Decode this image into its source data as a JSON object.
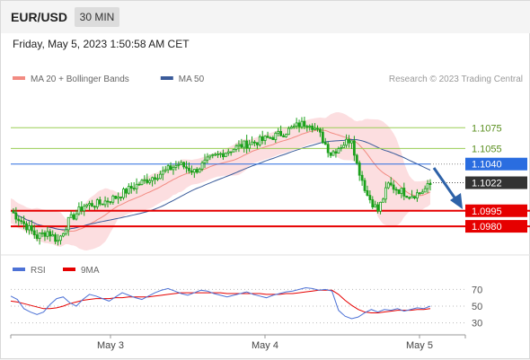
{
  "header": {
    "symbol": "EUR/USD",
    "timeframe": "30 MIN"
  },
  "datetime": "Friday, May 5, 2023 1:50:58 AM CET",
  "attribution": "Research © 2023 Trading Central",
  "colors": {
    "ma20": "#f28b82",
    "ma50": "#3b5b9a",
    "bollinger": "#fbd3d5",
    "green_level": "#9acd55",
    "blue_level": "#2a6de0",
    "red_level": "#e60000",
    "candle": "#1aa01a",
    "rsi": "#4d72d6",
    "rsi_ma": "#e60000",
    "arrow": "#2e62a8"
  },
  "chart_data": [
    {
      "type": "candlestick",
      "legend": [
        {
          "name": "MA 20 + Bollinger Bands",
          "color": "#f28b82"
        },
        {
          "name": "MA 50",
          "color": "#3b5b9a"
        }
      ],
      "x_ticks": [
        "May 3",
        "May 4",
        "May 5"
      ],
      "ylim": [
        1.0955,
        1.1115
      ],
      "levels": [
        {
          "value": 1.1075,
          "label": "1.1075",
          "kind": "target"
        },
        {
          "value": 1.1055,
          "label": "1.1055",
          "kind": "target"
        },
        {
          "value": 1.104,
          "label": "1.1040",
          "kind": "pivot"
        },
        {
          "value": 1.1022,
          "label": "1.1022",
          "kind": "last"
        },
        {
          "value": 1.0995,
          "label": "1.0995",
          "kind": "support"
        },
        {
          "value": 1.098,
          "label": "1.0980",
          "kind": "support"
        }
      ],
      "close_path": [
        [
          0,
          1.0995
        ],
        [
          4,
          1.0985
        ],
        [
          10,
          1.097
        ],
        [
          14,
          1.0975
        ],
        [
          18,
          1.0966
        ],
        [
          22,
          1.0985
        ],
        [
          28,
          1.1
        ],
        [
          34,
          1.1002
        ],
        [
          40,
          1.1008
        ],
        [
          46,
          1.1017
        ],
        [
          52,
          1.1025
        ],
        [
          58,
          1.1032
        ],
        [
          64,
          1.104
        ],
        [
          70,
          1.1033
        ],
        [
          76,
          1.1045
        ],
        [
          82,
          1.1052
        ],
        [
          88,
          1.1058
        ],
        [
          96,
          1.1063
        ],
        [
          104,
          1.107
        ],
        [
          110,
          1.1078
        ],
        [
          114,
          1.108
        ],
        [
          118,
          1.1068
        ],
        [
          122,
          1.105
        ],
        [
          126,
          1.1058
        ],
        [
          130,
          1.1065
        ],
        [
          132,
          1.104
        ],
        [
          136,
          1.101
        ],
        [
          140,
          1.0995
        ],
        [
          144,
          1.102
        ],
        [
          148,
          1.1015
        ],
        [
          152,
          1.101
        ],
        [
          156,
          1.1012
        ],
        [
          160,
          1.102
        ]
      ],
      "rsi": {
        "legend": [
          {
            "name": "RSI",
            "color": "#4d72d6"
          },
          {
            "name": "9MA",
            "color": "#e60000"
          }
        ],
        "ticks": [
          "70",
          "50",
          "30"
        ],
        "ylim": [
          20,
          80
        ],
        "rsi_values": [
          62,
          58,
          47,
          43,
          40,
          43,
          52,
          59,
          61,
          54,
          50,
          58,
          64,
          62,
          59,
          56,
          61,
          66,
          63,
          60,
          58,
          62,
          66,
          69,
          71,
          68,
          65,
          63,
          66,
          69,
          68,
          65,
          63,
          61,
          63,
          65,
          67,
          64,
          62,
          60,
          63,
          65,
          67,
          68,
          70,
          72,
          71,
          69,
          70,
          68,
          45,
          38,
          35,
          37,
          42,
          46,
          43,
          46,
          45,
          47,
          44,
          46,
          48,
          47,
          50
        ],
        "ma_values": [
          56,
          55,
          53,
          51,
          49,
          47,
          47,
          48,
          50,
          53,
          55,
          57,
          58,
          59,
          59,
          59,
          60,
          60,
          61,
          61,
          61,
          61,
          62,
          63,
          64,
          65,
          66,
          66,
          66,
          66,
          66,
          66,
          66,
          65,
          65,
          65,
          65,
          65,
          65,
          64,
          64,
          64,
          65,
          65,
          66,
          67,
          68,
          69,
          69,
          69,
          64,
          57,
          51,
          46,
          43,
          42,
          42,
          43,
          44,
          45,
          45,
          45,
          46,
          46,
          47
        ]
      }
    }
  ]
}
